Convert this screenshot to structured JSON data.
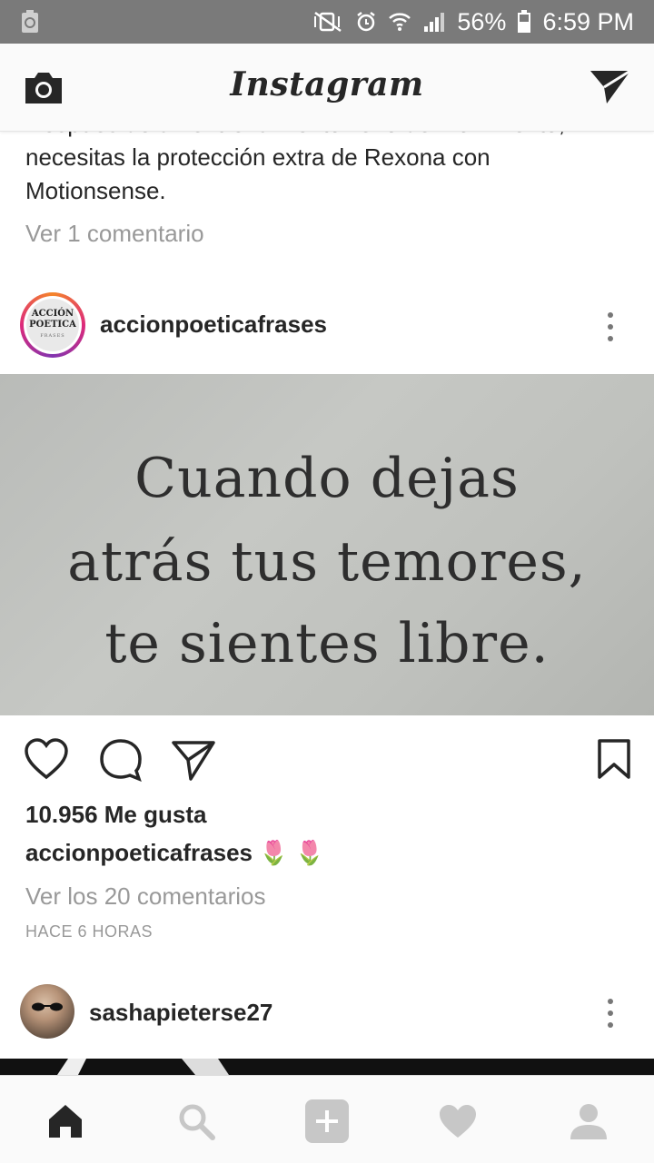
{
  "status_bar": {
    "battery_percent": "56%",
    "time": "6:59 PM",
    "icons": [
      "recycle-icon",
      "mute-vibrate-icon",
      "alarm-icon",
      "wifi-icon",
      "signal-icon",
      "battery-icon"
    ]
  },
  "app_bar": {
    "title": "Instagram",
    "left_icon": "camera-icon",
    "right_icon": "direct-message-icon"
  },
  "feed": {
    "prev_post": {
      "caption_cut": "Después de un entrenamiento lleno de movimiento,",
      "caption_line2": "necesitas la protección extra de Rexona con",
      "caption_line3": "Motionsense.",
      "view_comments": "Ver 1 comentario"
    },
    "post": {
      "username": "accionpoeticafrases",
      "avatar_text_1": "ACCIÓN",
      "avatar_text_2": "POETICA",
      "avatar_text_3": "FRASES",
      "image_text": {
        "line1": "Cuando dejas",
        "line2": "atrás tus temores,",
        "line3": "te sientes libre."
      },
      "likes": "10.956 Me gusta",
      "caption_user": "accionpoeticafrases",
      "caption_emoji": "🌷 🌷",
      "view_comments": "Ver los 20 comentarios",
      "time": "HACE 6 HORAS"
    },
    "next_post": {
      "username": "sashapieterse27"
    }
  },
  "bottom_nav": {
    "items": [
      "home-icon",
      "search-icon",
      "new-post-icon",
      "activity-icon",
      "profile-icon"
    ]
  }
}
